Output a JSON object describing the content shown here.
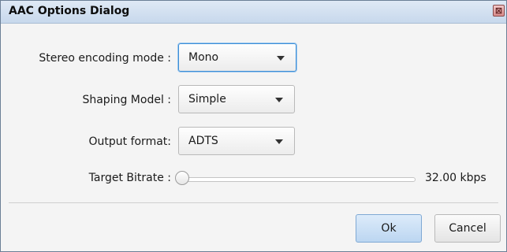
{
  "window": {
    "title": "AAC Options Dialog",
    "close_glyph": "⊠"
  },
  "form": {
    "stereo": {
      "label": "Stereo encoding mode :",
      "value": "Mono"
    },
    "shaping": {
      "label": "Shaping Model :",
      "value": "Simple"
    },
    "output": {
      "label": "Output format:",
      "value": "ADTS"
    },
    "bitrate": {
      "label": "Target Bitrate :",
      "value": "32.00 kbps",
      "slider_fraction": 0.0
    }
  },
  "buttons": {
    "ok": "Ok",
    "cancel": "Cancel"
  },
  "icons": {
    "close": "close-icon",
    "dropdown": "chevron-down-icon"
  },
  "colors": {
    "titlebar": "#c7d8ec",
    "focus": "#3c8ed6",
    "ok_button": "#bcd6f1"
  }
}
